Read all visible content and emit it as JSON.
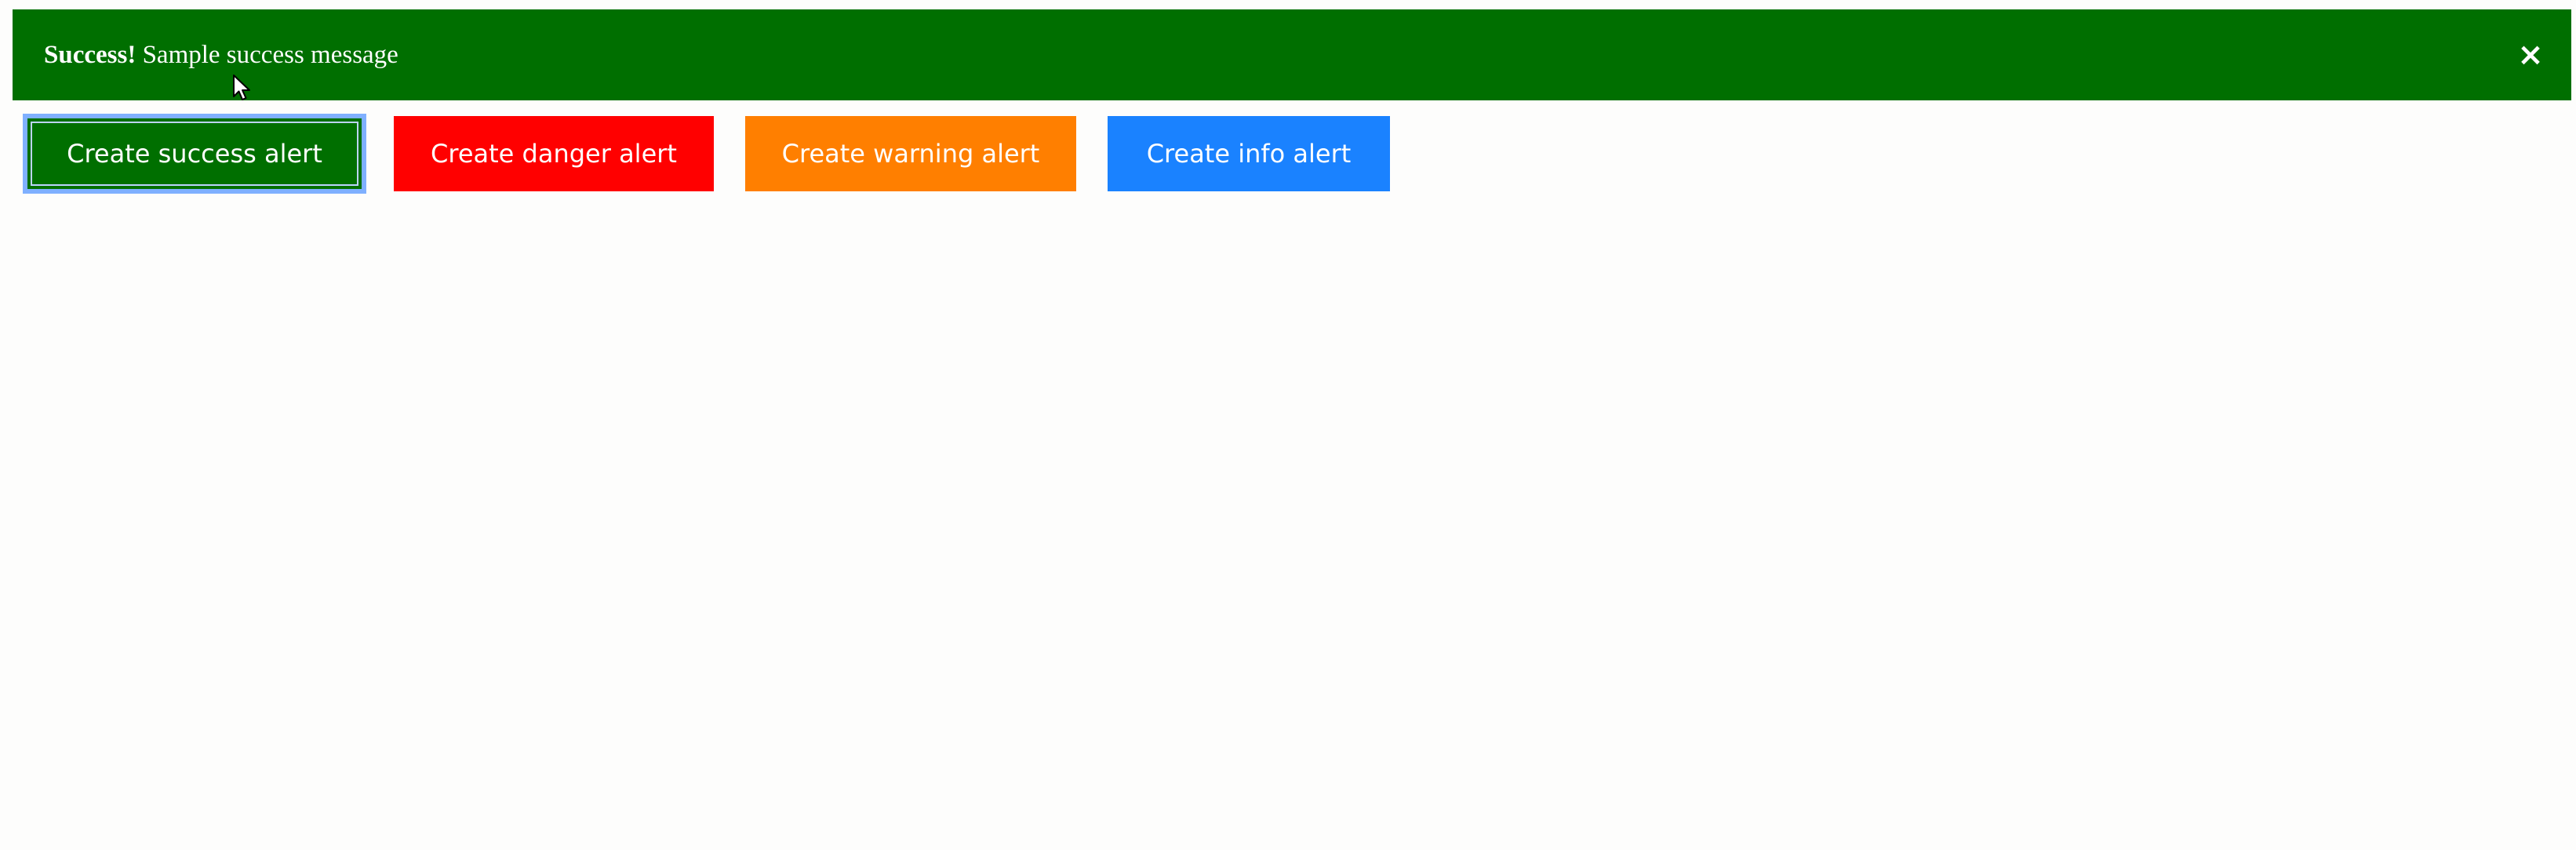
{
  "alert": {
    "strong": "Success!",
    "message": "Sample success message",
    "close_label": "×",
    "color": "#006f00"
  },
  "buttons": [
    {
      "label": "Create success alert",
      "color": "#006f00",
      "focused": true
    },
    {
      "label": "Create danger alert",
      "color": "#ff0000"
    },
    {
      "label": "Create warning alert",
      "color": "#ff7f00"
    },
    {
      "label": "Create info alert",
      "color": "#1a82ff"
    }
  ],
  "cursor_icon": "arrow-pointer-icon"
}
